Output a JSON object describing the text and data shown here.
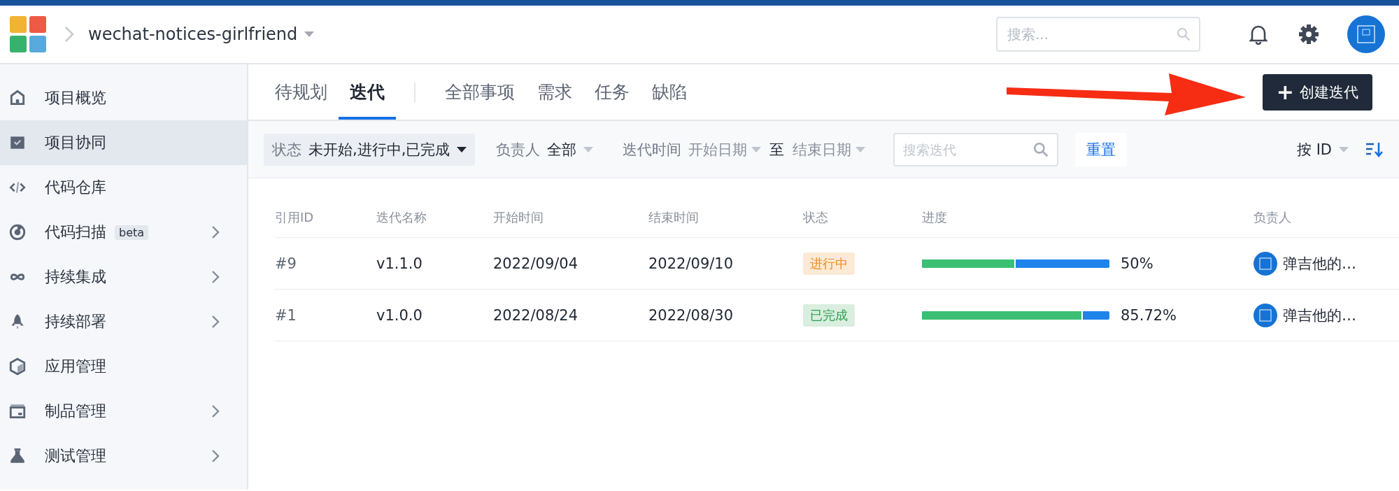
{
  "header": {
    "project": "wechat-notices-girlfriend",
    "search": {
      "placeholder": "搜索..."
    }
  },
  "sidebar": {
    "items": [
      {
        "label": "项目概览",
        "selected": false,
        "expandable": false
      },
      {
        "label": "项目协同",
        "selected": true,
        "expandable": false
      },
      {
        "label": "代码仓库",
        "selected": false,
        "expandable": false
      },
      {
        "label": "代码扫描",
        "badge": "beta",
        "selected": false,
        "expandable": true
      },
      {
        "label": "持续集成",
        "selected": false,
        "expandable": true
      },
      {
        "label": "持续部署",
        "selected": false,
        "expandable": true
      },
      {
        "label": "应用管理",
        "selected": false,
        "expandable": false
      },
      {
        "label": "制品管理",
        "selected": false,
        "expandable": true
      },
      {
        "label": "测试管理",
        "selected": false,
        "expandable": true
      }
    ]
  },
  "tab_groups": [
    {
      "tabs": [
        {
          "label": "待规划",
          "selected": false
        },
        {
          "label": "迭代",
          "selected": true
        }
      ]
    },
    {
      "tabs": [
        {
          "label": "全部事项",
          "selected": false
        },
        {
          "label": "需求",
          "selected": false
        },
        {
          "label": "任务",
          "selected": false
        },
        {
          "label": "缺陷",
          "selected": false
        }
      ]
    }
  ],
  "create_button": {
    "icon": "+",
    "label": "创建迭代"
  },
  "filters": [
    {
      "kind": "select",
      "label": "状态",
      "value": "未开始,进行中,已完成",
      "active": true
    },
    {
      "kind": "select",
      "label": "负责人",
      "value": "全部",
      "active": false
    },
    {
      "kind": "date_range",
      "label": "迭代时间",
      "start": "开始日期",
      "separator": "至",
      "end": "结束日期"
    }
  ],
  "filter_search": {
    "placeholder": "搜索迭代"
  },
  "reset_button": "重置",
  "sort": {
    "label": "按 ID"
  },
  "table": {
    "columns": [
      "引用ID",
      "迭代名称",
      "开始时间",
      "结束时间",
      "状态",
      "进度",
      "负责人"
    ],
    "rows": [
      {
        "id": "#9",
        "name": "v1.1.0",
        "start": "2022/09/04",
        "end": "2022/09/10",
        "status": {
          "label": "进行中",
          "color": "#f08c1e"
        },
        "progress": {
          "level": 0.5,
          "reading": "50%"
        },
        "owner": "弹吉他的…"
      },
      {
        "id": "#1",
        "name": "v1.0.0",
        "start": "2022/08/24",
        "end": "2022/08/30",
        "status": {
          "label": "已完成",
          "color": "#2e9e50"
        },
        "progress": {
          "level": 0.8572,
          "reading": "85.72%"
        },
        "owner": "弹吉他的…"
      }
    ]
  }
}
